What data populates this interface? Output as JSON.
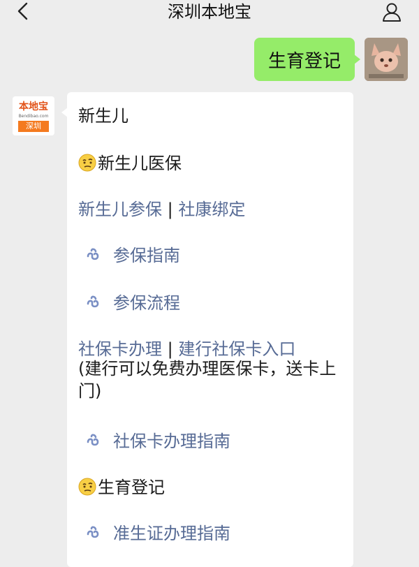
{
  "header": {
    "title": "深圳本地宝"
  },
  "user_message": {
    "text": "生育登记"
  },
  "bot": {
    "logo_text": "本地宝",
    "logo_url": "Bendibao.com",
    "logo_city": "深圳",
    "line_newborn": "新生儿",
    "section1_title": "新生儿医保",
    "link_insure": "新生儿参保",
    "sep": "|",
    "link_bind": "社康绑定",
    "mini1": "参保指南",
    "mini2": "参保流程",
    "link_card": "社保卡办理",
    "link_ccb": "建行社保卡入口",
    "note": "(建行可以免费办理医保卡，送卡上门)",
    "mini3": "社保卡办理指南",
    "section2_title": "生育登记",
    "mini4": "准生证办理指南"
  }
}
